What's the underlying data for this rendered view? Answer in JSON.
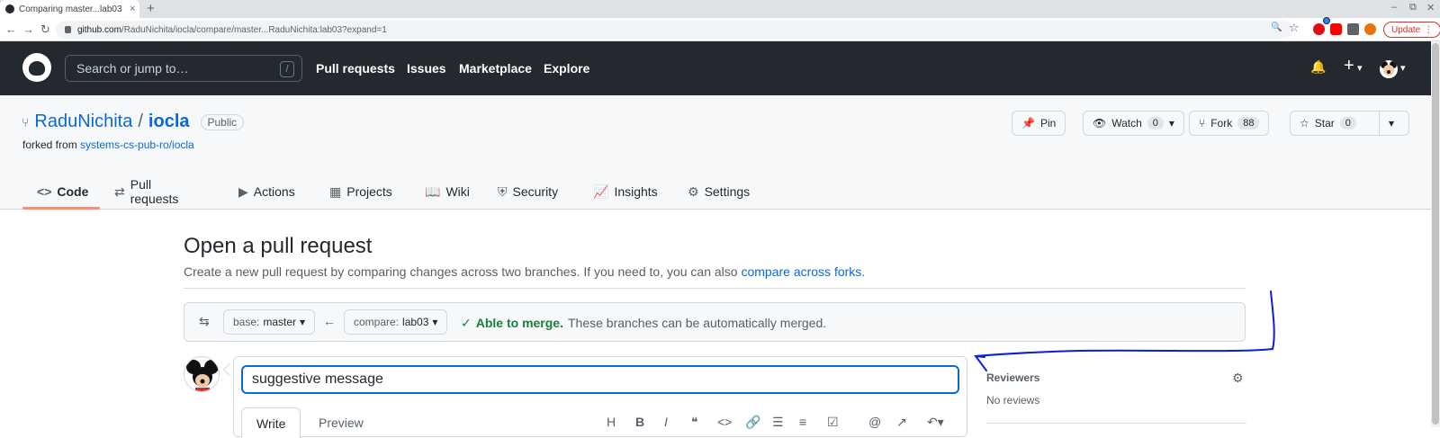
{
  "browser": {
    "tab_title": "Comparing master...lab03",
    "tab_close": "×",
    "new_tab": "+",
    "window_controls": [
      "–",
      "⧉",
      "✕"
    ],
    "url_host": "github.com",
    "url_path": "/RaduNichita/iocla/compare/master...RaduNichita:lab03?expand=1",
    "update_label": "Update",
    "update_menu": "⋮",
    "nav": {
      "back": "←",
      "forward": "→",
      "reload": "↻"
    },
    "icons": {
      "zoom": "🔍",
      "star": "☆"
    }
  },
  "gh_header": {
    "search_placeholder": "Search or jump to…",
    "search_shortcut": "/",
    "nav": [
      "Pull requests",
      "Issues",
      "Marketplace",
      "Explore"
    ],
    "bell": "🔔",
    "plus": "+",
    "caret": "▾"
  },
  "repo": {
    "owner": "RaduNichita",
    "separator": "/",
    "name": "iocla",
    "visibility": "Public",
    "forked_prefix": "forked from",
    "forked_from": "systems-cs-pub-ro/iocla",
    "buttons": {
      "pin": "Pin",
      "watch": "Watch",
      "watch_count": "0",
      "fork": "Fork",
      "fork_count": "88",
      "star": "Star",
      "star_count": "0",
      "caret": "▾"
    },
    "tabs": [
      {
        "label": "Code",
        "icon": "<>"
      },
      {
        "label": "Pull requests",
        "icon": "⇄"
      },
      {
        "label": "Actions",
        "icon": "▶"
      },
      {
        "label": "Projects",
        "icon": "▦"
      },
      {
        "label": "Wiki",
        "icon": "📖"
      },
      {
        "label": "Security",
        "icon": "⛨"
      },
      {
        "label": "Insights",
        "icon": "📈"
      },
      {
        "label": "Settings",
        "icon": "⚙"
      }
    ]
  },
  "compare": {
    "title": "Open a pull request",
    "subtitle": "Create a new pull request by comparing changes across two branches. If you need to, you can also",
    "subtitle_link": "compare across forks.",
    "range_icon": "⇆",
    "arrow": "←",
    "base_label": "base:",
    "base_value": "master",
    "compare_label": "compare:",
    "compare_value": "lab03",
    "caret": "▾",
    "check": "✓",
    "merge_ok": "Able to merge.",
    "merge_msg": "These branches can be automatically merged."
  },
  "editor": {
    "title_value": "suggestive message",
    "tab_write": "Write",
    "tab_preview": "Preview",
    "toolbar": [
      "H",
      "B",
      "I",
      "❝",
      "<>",
      "🔗",
      "☰",
      "≡",
      "☑",
      "@",
      "↗",
      "↶▾"
    ]
  },
  "sidebar": {
    "reviewers_title": "Reviewers",
    "gear": "⚙",
    "reviewers_value": "No reviews"
  },
  "annotation": {
    "color": "#0a1fd6"
  }
}
